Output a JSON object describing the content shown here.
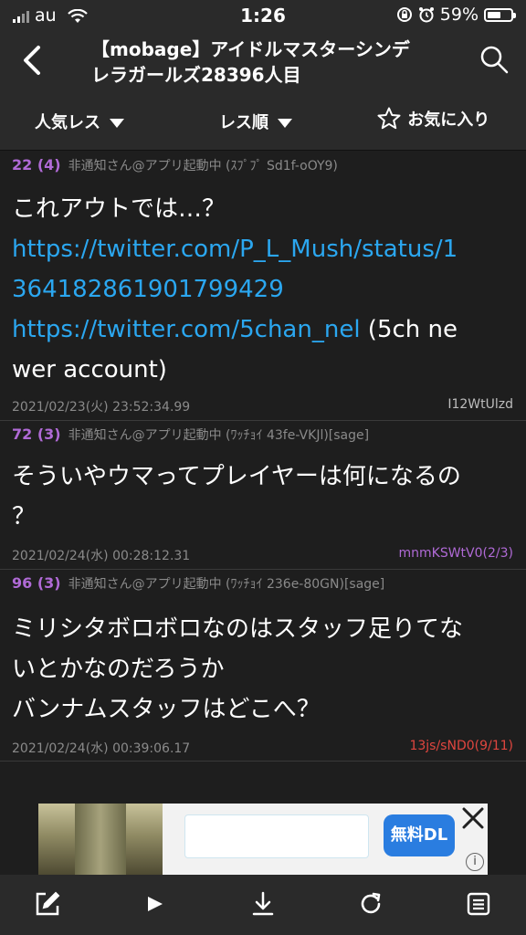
{
  "status": {
    "carrier": "au",
    "time": "1:26",
    "battery_text": "59%",
    "battery_level": 0.59
  },
  "header": {
    "title_line1": "【mobage】アイドルマスターシンデ",
    "title_line2": "レラガールズ28396人目"
  },
  "toolbar": {
    "popular_label": "人気レス",
    "order_label": "レス順",
    "favorite_label": "お気に入り"
  },
  "posts": [
    {
      "number": "22",
      "count": "(4)",
      "name": "非通知さん@アプリ起動中 (ｽﾌﾟﾌﾟ Sd1f-oOY9)",
      "text_line1": "これアウトでは…？",
      "link1_a": "https://twitter.com/P_L_Mush/status/1",
      "link1_b": "364182861901799429",
      "link2": "https://twitter.com/5chan_nel",
      "text_after_link2": " (5ch ne",
      "text_line_last": "wer account)",
      "date": "2021/02/23(火) 23:52:34.99",
      "id": "I12WtUlzd",
      "id_color": "#bdbdbd"
    },
    {
      "number": "72",
      "count": "(3)",
      "name": "非通知さん@アプリ起動中 (ﾜｯﾁｮｲ 43fe-VKJl)[sage]",
      "text_line1": "そういやウマってプレイヤーは何になるの",
      "text_line2": "？",
      "date": "2021/02/24(水) 00:28:12.31",
      "id": "mnmKSWtV0(2/3)",
      "id_color": "#b06ad6"
    },
    {
      "number": "96",
      "count": "(3)",
      "name": "非通知さん@アプリ起動中 (ﾜｯﾁｮｲ 236e-80GN)[sage]",
      "text_line1": "ミリシタボロボロなのはスタッフ足りてな",
      "text_line2": "いとかなのだろうか",
      "text_line3": "バンナムスタッフはどこへ？",
      "date": "2021/02/24(水) 00:39:06.17",
      "id": "13js/sND0(9/11)",
      "id_color": "#e0463f"
    }
  ],
  "ad": {
    "button_label": "無料DL",
    "info_label": "i"
  },
  "bottom_bar": {
    "icons": [
      "compose-icon",
      "play-icon",
      "download-icon",
      "refresh-icon",
      "menu-icon"
    ]
  },
  "colors": {
    "background": "#1e1e1e",
    "bar": "#2a2a2a",
    "link": "#2ba7f0",
    "post_number": "#b06ad6",
    "meta": "#8a8a8a"
  }
}
